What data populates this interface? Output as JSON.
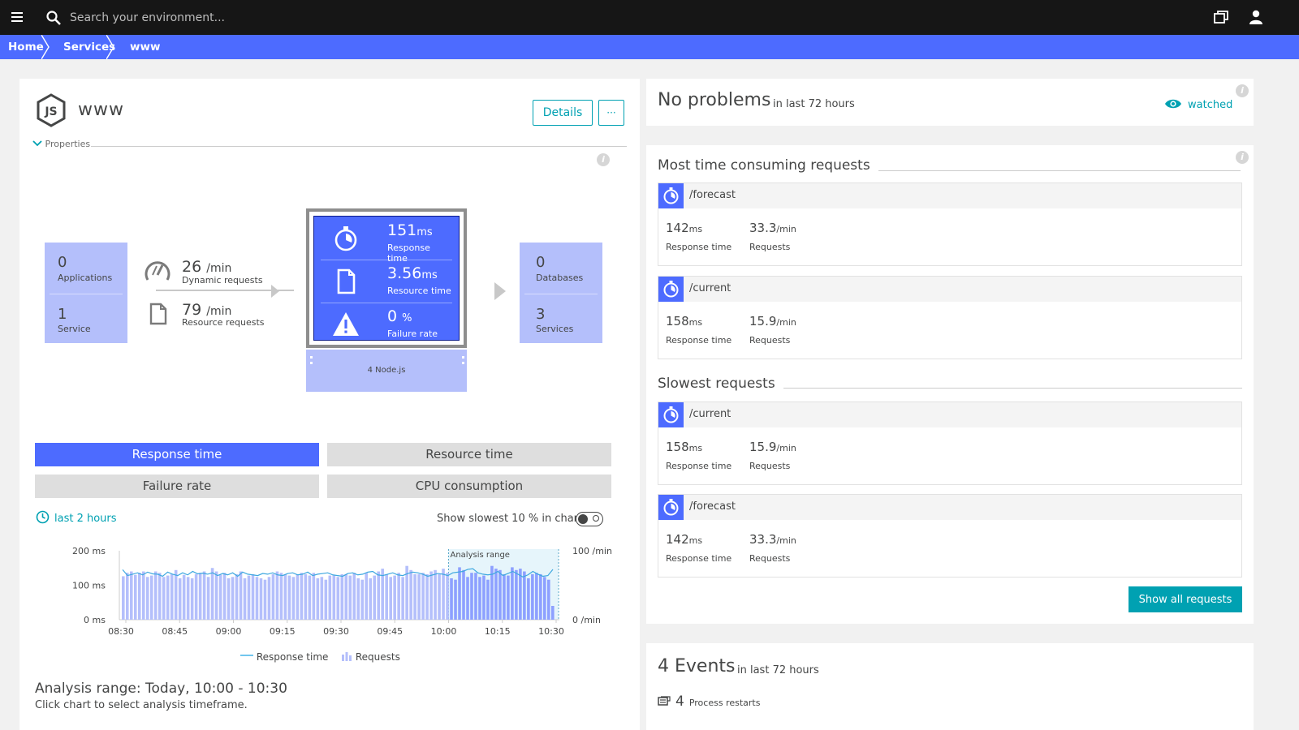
{
  "topbar": {
    "search_placeholder": "Search your environment..."
  },
  "breadcrumb": [
    "Home",
    "Services",
    "www"
  ],
  "service": {
    "name": "www",
    "details_label": "Details",
    "more_label": "···",
    "properties_label": "Properties"
  },
  "flow": {
    "applications": {
      "value": "0",
      "label": "Applications"
    },
    "service": {
      "value": "1",
      "label": "Service"
    },
    "dynamic_requests": {
      "value": "26",
      "unit": "/min",
      "label": "Dynamic requests"
    },
    "resource_requests": {
      "value": "79",
      "unit": "/min",
      "label": "Resource requests"
    },
    "databases": {
      "value": "0",
      "label": "Databases"
    },
    "services": {
      "value": "3",
      "label": "Services"
    }
  },
  "core": {
    "response_time": {
      "value": "151",
      "unit": "ms",
      "label": "Response time"
    },
    "resource_time": {
      "value": "3.56",
      "unit": "ms",
      "label": "Resource time"
    },
    "failure_rate": {
      "value": "0",
      "unit": "%",
      "label": "Failure rate"
    },
    "nodes_label": "4 Node.js"
  },
  "tabs": [
    {
      "label": "Response time",
      "active": true
    },
    {
      "label": "Resource time",
      "active": false
    },
    {
      "label": "Failure rate",
      "active": false
    },
    {
      "label": "CPU consumption",
      "active": false
    }
  ],
  "timeframe": "last 2 hours",
  "slowest_label": "Show slowest 10 % in chart",
  "chart_data": {
    "type": "bar",
    "x_ticks": [
      "08:30",
      "08:45",
      "09:00",
      "09:15",
      "09:30",
      "09:45",
      "10:00",
      "10:15",
      "10:30"
    ],
    "y_left_ticks": [
      "200 ms",
      "100 ms",
      "0 ms"
    ],
    "y_right_ticks": [
      "100 /min",
      "0 /min"
    ],
    "ylim_left": [
      0,
      200
    ],
    "ylim_right": [
      0,
      100
    ],
    "analysis_range_label": "Analysis range",
    "analysis_range": [
      "10:00",
      "10:30"
    ],
    "series": [
      {
        "name": "Requests",
        "type": "bar",
        "values": [
          63,
          68,
          70,
          65,
          68,
          70,
          62,
          64,
          70,
          68,
          62,
          64,
          66,
          72,
          60,
          65,
          62,
          60,
          66,
          68,
          70,
          62,
          75,
          70,
          65,
          68,
          60,
          62,
          66,
          70,
          60,
          64,
          66,
          62,
          60,
          58,
          62,
          66,
          70,
          68,
          66,
          64,
          62,
          66,
          68,
          66,
          64,
          68,
          60,
          62,
          58,
          64,
          64,
          62,
          66,
          66,
          64,
          68,
          60,
          58,
          68,
          60,
          64,
          70,
          74,
          66,
          62,
          64,
          68,
          62,
          78,
          72,
          66,
          66,
          68,
          66,
          70,
          72,
          66,
          74,
          68,
          60,
          58,
          76,
          72,
          62,
          68,
          68,
          62,
          64,
          58,
          78,
          74,
          72,
          66,
          64,
          76,
          72,
          74,
          70,
          60,
          66,
          68,
          66,
          62,
          58,
          20
        ]
      },
      {
        "name": "Response time",
        "type": "line",
        "values": [
          145,
          128,
          132,
          136,
          130,
          138,
          133,
          132,
          126,
          138,
          132,
          128,
          136,
          130,
          140,
          133,
          135,
          132,
          136,
          128,
          134,
          130,
          136,
          126,
          138,
          132,
          130,
          128,
          134,
          132,
          136,
          130,
          128,
          134,
          136,
          130,
          132,
          138,
          128,
          132,
          134,
          136,
          130,
          128,
          126,
          134,
          136,
          130,
          132,
          138,
          140,
          130,
          128,
          132,
          136,
          130,
          128,
          134,
          138,
          136,
          132,
          126,
          130,
          134,
          132,
          128,
          136,
          138,
          140,
          146,
          148,
          136,
          132,
          130,
          132,
          140,
          128,
          134,
          140,
          132,
          124,
          130,
          140,
          132,
          126,
          128,
          146
        ]
      }
    ],
    "legend": [
      "Response time",
      "Requests"
    ]
  },
  "analysis": {
    "title": "Analysis range: Today, 10:00 - 10:30",
    "hint": "Click chart to select analysis timeframe."
  },
  "problems": {
    "title": "No problems",
    "subtitle": "in last 72 hours",
    "watched_label": "watched"
  },
  "most_time_consuming": {
    "title": "Most time consuming requests",
    "items": [
      {
        "name": "/forecast",
        "rt": "142",
        "rt_unit": "ms",
        "rt_label": "Response time",
        "req": "33.3",
        "req_unit": "/min",
        "req_label": "Requests"
      },
      {
        "name": "/current",
        "rt": "158",
        "rt_unit": "ms",
        "rt_label": "Response time",
        "req": "15.9",
        "req_unit": "/min",
        "req_label": "Requests"
      }
    ]
  },
  "slowest": {
    "title": "Slowest requests",
    "items": [
      {
        "name": "/current",
        "rt": "158",
        "rt_unit": "ms",
        "rt_label": "Response time",
        "req": "15.9",
        "req_unit": "/min",
        "req_label": "Requests"
      },
      {
        "name": "/forecast",
        "rt": "142",
        "rt_unit": "ms",
        "rt_label": "Response time",
        "req": "33.3",
        "req_unit": "/min",
        "req_label": "Requests"
      }
    ]
  },
  "show_all_label": "Show all requests",
  "events": {
    "count": "4",
    "title": "Events",
    "subtitle": "in last 72 hours",
    "row_count": "4",
    "row_label": "Process restarts"
  },
  "colors": {
    "accent_blue": "#4d6bff",
    "teal": "#00a1b2",
    "light_blue": "#b4bffb",
    "topbar": "#161616"
  }
}
